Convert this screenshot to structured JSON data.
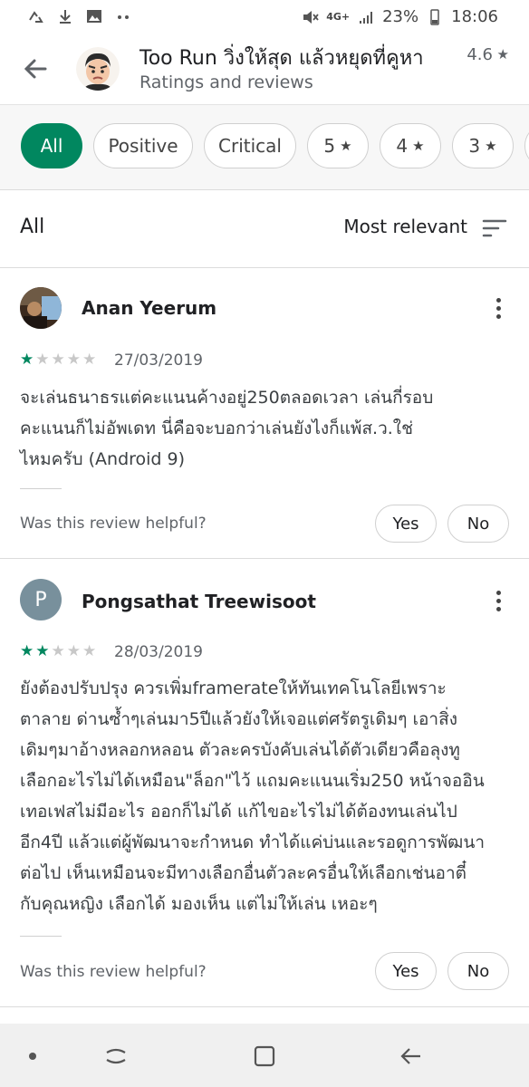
{
  "status_bar": {
    "network": "4G+",
    "battery": "23%",
    "time": "18:06"
  },
  "app": {
    "title": "Too Run วิ่งให้สุด แล้วหยุดที่คูหา",
    "rating": "4.6",
    "subtitle": "Ratings and reviews"
  },
  "filters": [
    {
      "label": "All",
      "active": true
    },
    {
      "label": "Positive",
      "active": false
    },
    {
      "label": "Critical",
      "active": false
    },
    {
      "label": "5",
      "icon": "star-icon",
      "active": false
    },
    {
      "label": "4",
      "icon": "star-icon",
      "active": false
    },
    {
      "label": "3",
      "icon": "star-icon",
      "active": false
    }
  ],
  "sort": {
    "section_title": "All",
    "sort_label": "Most relevant"
  },
  "reviews": [
    {
      "name": "Anan Yeerum",
      "avatar": "photo-avatar",
      "rating": 1,
      "date": "27/03/2019",
      "text": "จะเล่นธนาธรแต่คะแนนค้างอยู่250ตลอดเวลา เล่นกี่รอบ\nคะแนนก็ไม่อัพเดท นี่คือจะบอกว่าเล่นยังไงก็แพ้ส.ว.ใช่\nไหมครับ (Android 9)",
      "helpful_question": "Was this review helpful?",
      "yes_label": "Yes",
      "no_label": "No"
    },
    {
      "name": "Pongsathat Treewisoot",
      "avatar_letter": "P",
      "rating": 2,
      "date": "28/03/2019",
      "text": "ยังต้องปรับปรุง ควรเพิ่มframerateให้ทันเทคโนโลยีเพราะ\nตาลาย ด่านซ้ำๆเล่นมา5ปีแล้วยังให้เจอแต่ศรัตรูเดิมๆ เอาสิ่ง\nเดิมๆมาอ้างหลอกหลอน ตัวละครบังคับเล่นได้ตัวเดียวคือลุงทู\nเลือกอะไรไม่ได้เหมือน\"ล็อก\"ไว้ แถมคะแนนเริ่ม250 หน้าจออิน\nเทอเฟสไม่มีอะไร ออกก็ไม่ได้ แก้ไขอะไรไม่ได้ต้องทนเล่นไป\nอีก4ปี แล้วแต่ผู้พัฒนาจะกำหนด ทำได้แค่บ่นและรอดูการพัฒนา\nต่อไป เห็นเหมือนจะมีทางเลือกอื่นตัวละครอื่นให้เลือกเช่นอาตี๋\nกับคุณหญิง เลือกได้ มองเห็น แต่ไม่ให้เล่น เหอะๆ",
      "helpful_question": "Was this review helpful?",
      "yes_label": "Yes",
      "no_label": "No"
    }
  ],
  "colors": {
    "accent": "#01875f",
    "star_off": "#c8c8c8"
  }
}
